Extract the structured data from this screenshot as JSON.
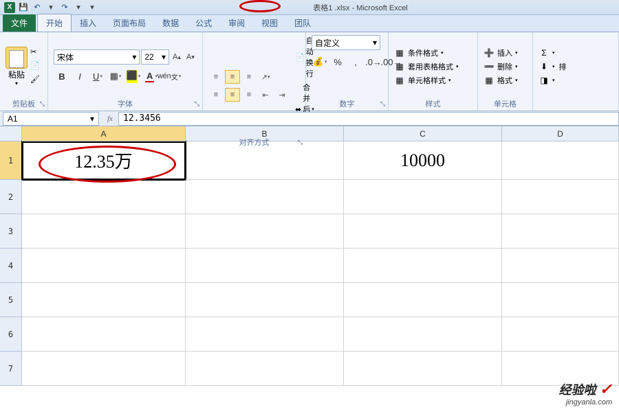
{
  "app": {
    "title": "表格1 .xlsx - Microsoft Excel"
  },
  "qat": {
    "save": "💾",
    "undo": "↶",
    "redo": "↷"
  },
  "tabs": {
    "file": "文件",
    "items": [
      "开始",
      "插入",
      "页面布局",
      "数据",
      "公式",
      "审阅",
      "视图",
      "团队"
    ]
  },
  "ribbon": {
    "clipboard": {
      "label": "剪贴板",
      "paste": "粘贴"
    },
    "font": {
      "label": "字体",
      "name": "宋体",
      "size": "22"
    },
    "align": {
      "label": "对齐方式",
      "wrap": "自动换行",
      "merge": "合并后居中"
    },
    "number": {
      "label": "数字",
      "format": "自定义"
    },
    "styles": {
      "label": "样式",
      "cond": "条件格式",
      "table": "套用表格格式",
      "cell": "单元格样式"
    },
    "cells": {
      "label": "单元格",
      "insert": "插入",
      "delete": "删除",
      "format": "格式"
    },
    "editing": {
      "label": "",
      "sort": "排"
    }
  },
  "namebox": {
    "cell": "A1"
  },
  "formula": {
    "value": "12.3456"
  },
  "columns": [
    "A",
    "B",
    "C",
    "D"
  ],
  "rows": [
    "1",
    "2",
    "3",
    "4",
    "5",
    "6",
    "7"
  ],
  "cells": {
    "A1": "12.35万",
    "C1": "10000"
  },
  "watermark": {
    "line1": "经验啦",
    "check": "✓",
    "line2": "jingyanla.com"
  }
}
